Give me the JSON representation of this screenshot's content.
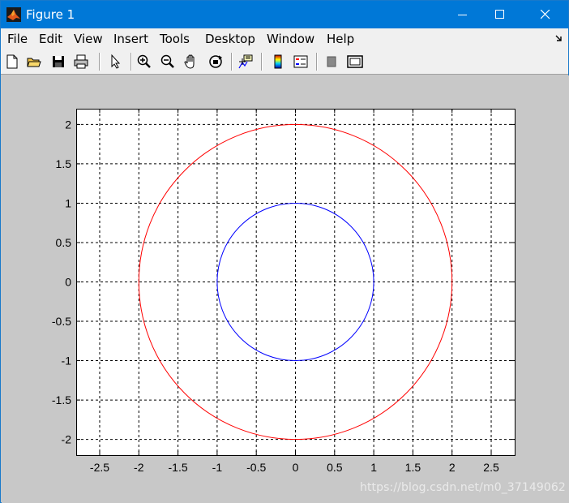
{
  "window": {
    "title": "Figure 1",
    "title_bar_color": "#0078d7"
  },
  "menu": {
    "items": [
      {
        "label": "File",
        "underline": "F"
      },
      {
        "label": "Edit",
        "underline": "E"
      },
      {
        "label": "View",
        "underline": "V"
      },
      {
        "label": "Insert",
        "underline": "I"
      },
      {
        "label": "Tools",
        "underline": "T"
      },
      {
        "label": "Desktop",
        "underline": "D"
      },
      {
        "label": "Window",
        "underline": "W"
      },
      {
        "label": "Help",
        "underline": "H"
      }
    ]
  },
  "toolbar": {
    "icons": [
      "new-figure-icon",
      "open-file-icon",
      "save-icon",
      "print-icon",
      "edit-plot-arrow-icon",
      "zoom-in-icon",
      "zoom-out-icon",
      "pan-hand-icon",
      "rotate-3d-icon",
      "data-cursor-icon",
      "colorbar-icon",
      "legend-icon",
      "hide-plot-tools-icon",
      "show-plot-tools-icon"
    ]
  },
  "chart_data": {
    "type": "line",
    "title": "",
    "xlabel": "",
    "ylabel": "",
    "xlim": [
      -2.8,
      2.8
    ],
    "ylim": [
      -2.2,
      2.2
    ],
    "x_ticks": [
      "-2.5",
      "-2",
      "-1.5",
      "-1",
      "-0.5",
      "0",
      "0.5",
      "1",
      "1.5",
      "2",
      "2.5"
    ],
    "x_tick_values": [
      -2.5,
      -2,
      -1.5,
      -1,
      -0.5,
      0,
      0.5,
      1,
      1.5,
      2,
      2.5
    ],
    "y_ticks": [
      "2",
      "1.5",
      "1",
      "0.5",
      "0",
      "-0.5",
      "-1",
      "-1.5",
      "-2"
    ],
    "y_tick_values": [
      2,
      1.5,
      1,
      0.5,
      0,
      -0.5,
      -1,
      -1.5,
      -2
    ],
    "grid": true,
    "grid_style": "dashed",
    "series": [
      {
        "shape": "circle",
        "center": [
          0,
          0
        ],
        "radius": 1,
        "color": "#0000ff"
      },
      {
        "shape": "circle",
        "center": [
          0,
          0
        ],
        "radius": 2,
        "color": "#ff0000"
      }
    ]
  },
  "watermark": "https://blog.csdn.net/m0_37149062"
}
